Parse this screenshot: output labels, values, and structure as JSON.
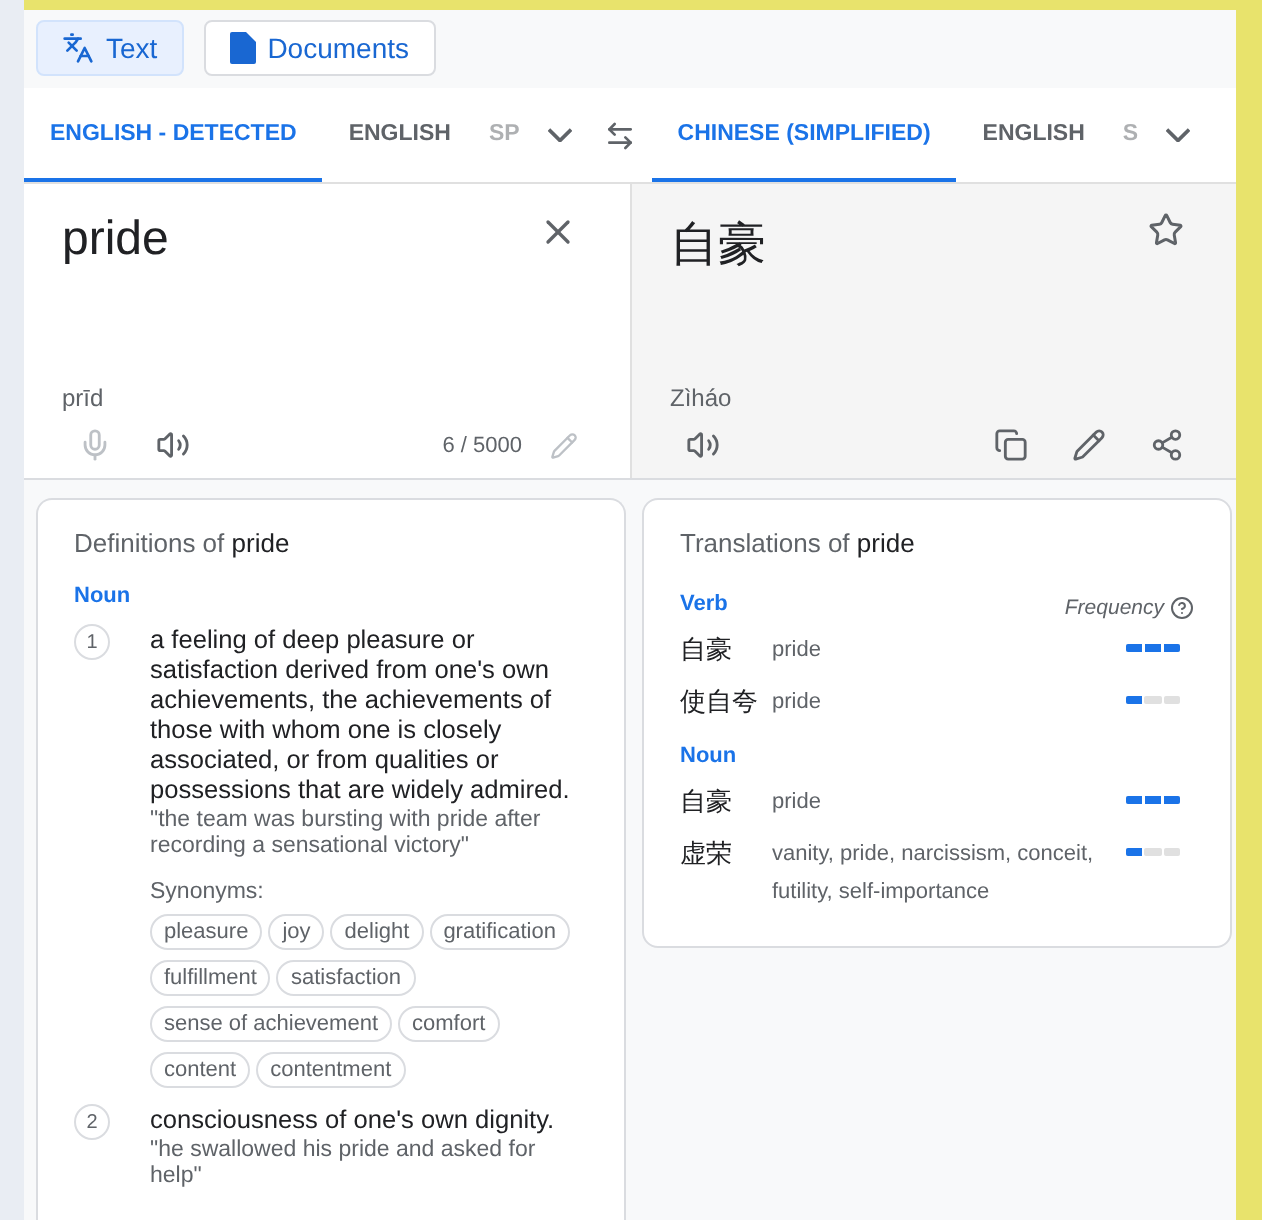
{
  "modes": [
    {
      "kind": "text",
      "label": "Text",
      "selected": true
    },
    {
      "kind": "documents",
      "label": "Documents",
      "selected": false
    }
  ],
  "source_languages": [
    {
      "label": "ENGLISH - DETECTED",
      "selected": true,
      "faded": false
    },
    {
      "label": "ENGLISH",
      "selected": false,
      "faded": false
    },
    {
      "label": "SP",
      "selected": false,
      "faded": true
    }
  ],
  "target_languages": [
    {
      "label": "CHINESE (SIMPLIFIED)",
      "selected": true,
      "faded": false
    },
    {
      "label": "ENGLISH",
      "selected": false,
      "faded": false
    },
    {
      "label": "S",
      "selected": false,
      "faded": true
    }
  ],
  "source": {
    "value": "pride",
    "pronunciation": "prīd",
    "char_count": "6 / 5000",
    "tools": [
      {
        "kind": "mic",
        "disabled": true
      },
      {
        "kind": "speaker",
        "disabled": false
      }
    ],
    "edit_disabled": true
  },
  "target": {
    "value": "自豪",
    "pronunciation": "Zìháo",
    "tools": [
      {
        "kind": "copy",
        "disabled": false
      },
      {
        "kind": "edit",
        "disabled": false
      },
      {
        "kind": "share",
        "disabled": false
      }
    ]
  },
  "definitions": {
    "title": "Definitions of **pride**",
    "part_of_speech": "Noun",
    "senses": [
      {
        "number": "1",
        "text": "a feeling of deep pleasure or satisfaction derived from one's own achievements, the achievements of those with whom one is closely associated, or from qualities or possessions that are widely admired.",
        "example": "\"the team was bursting with pride after recording a sensational victory\"",
        "synonyms_label": "Synonyms:",
        "synonyms": [
          "pleasure",
          "joy",
          "delight",
          "gratification",
          "fulfillment",
          "satisfaction",
          "sense of achievement",
          "comfort",
          "content",
          "contentment"
        ]
      },
      {
        "number": "2",
        "text": "consciousness of one's own dignity.",
        "example": "\"he swallowed his pride and asked for help\""
      }
    ]
  },
  "translations": {
    "title": "Translations of **pride**",
    "frequency_label": "Frequency",
    "groups": [
      {
        "part_of_speech": "Verb",
        "rows": [
          {
            "word": "自豪",
            "meanings": "pride",
            "level": 1
          },
          {
            "word": "使自夸",
            "meanings": "pride",
            "level": 0.33
          }
        ]
      },
      {
        "part_of_speech": "Noun",
        "rows": [
          {
            "word": "自豪",
            "meanings": "pride",
            "level": 1
          },
          {
            "word": "虚荣",
            "meanings": "vanity, pride, narcissism, conceit, futility, self-importance",
            "level": 0.33
          }
        ]
      }
    ]
  }
}
